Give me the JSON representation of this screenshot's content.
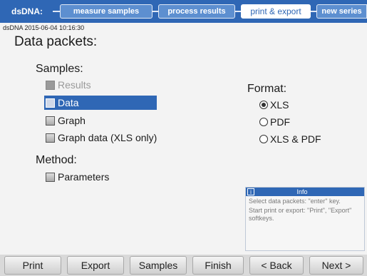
{
  "tabs": {
    "root": "dsDNA:",
    "measure": "measure samples",
    "process": "process results",
    "print": "print & export",
    "newseries": "new series"
  },
  "timestamp": "dsDNA 2015-06-04 10:16:30",
  "title": "Data packets:",
  "samples": {
    "label": "Samples:",
    "items": [
      {
        "label": "Results",
        "checked": true,
        "disabled": true
      },
      {
        "label": "Data",
        "checked": false,
        "selected": true
      },
      {
        "label": "Graph",
        "checked": false
      },
      {
        "label": "Graph data (XLS only)",
        "checked": false
      }
    ]
  },
  "method": {
    "label": "Method:",
    "items": [
      {
        "label": "Parameters",
        "checked": false
      }
    ]
  },
  "format": {
    "label": "Format:",
    "options": [
      {
        "label": "XLS",
        "selected": true
      },
      {
        "label": "PDF",
        "selected": false
      },
      {
        "label": "XLS & PDF",
        "selected": false
      }
    ]
  },
  "info": {
    "title": "Info",
    "line1": "Select data packets: \"enter\" key.",
    "line2": "Start print or export: \"Print\", \"Export\" softkeys."
  },
  "softkeys": {
    "print": "Print",
    "export": "Export",
    "samples": "Samples",
    "finish": "Finish",
    "back": "< Back",
    "next": "Next >"
  }
}
